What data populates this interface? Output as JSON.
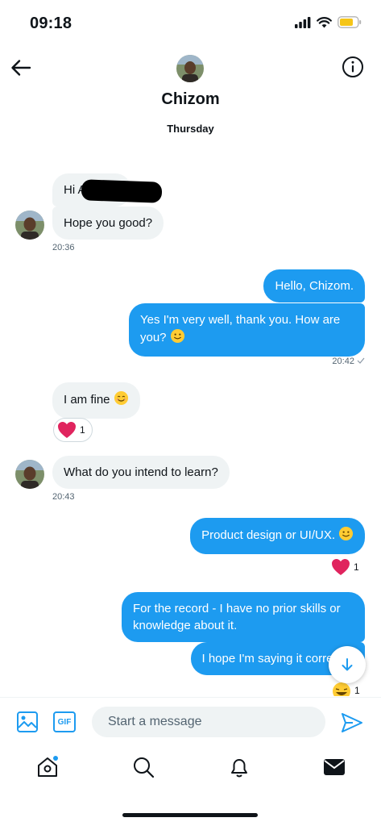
{
  "status_bar": {
    "time": "09:18"
  },
  "header": {
    "name": "Chizom",
    "day": "Thursday"
  },
  "messages": {
    "m1": "Hi A",
    "m2": "Hope you good?",
    "t1": "20:36",
    "m3": "Hello, Chizom.",
    "m4_line1": "Yes I'm very well, thank you. How are",
    "m4_line2": "you?",
    "t2": "20:42",
    "m5": "I am fine",
    "r1_count": "1",
    "m6": "What do you intend to learn?",
    "t3": "20:43",
    "m7": "Product design or UI/UX.",
    "r2_count": "1",
    "m8_line1": "For the record - I have no prior skills or",
    "m8_line2": "knowledge about it.",
    "m9": "I hope I'm saying it correctly.",
    "r3_count": "1"
  },
  "composer": {
    "placeholder": "Start a message",
    "gif_label": "GIF"
  },
  "colors": {
    "accent": "#1d9bf0",
    "incoming_bubble": "#eff3f4",
    "heart": "#f4212e"
  },
  "icons": [
    "back-arrow-icon",
    "info-icon",
    "image-icon",
    "gif-icon",
    "send-icon",
    "home-icon",
    "search-icon",
    "bell-icon",
    "mail-icon",
    "scroll-down-icon"
  ]
}
